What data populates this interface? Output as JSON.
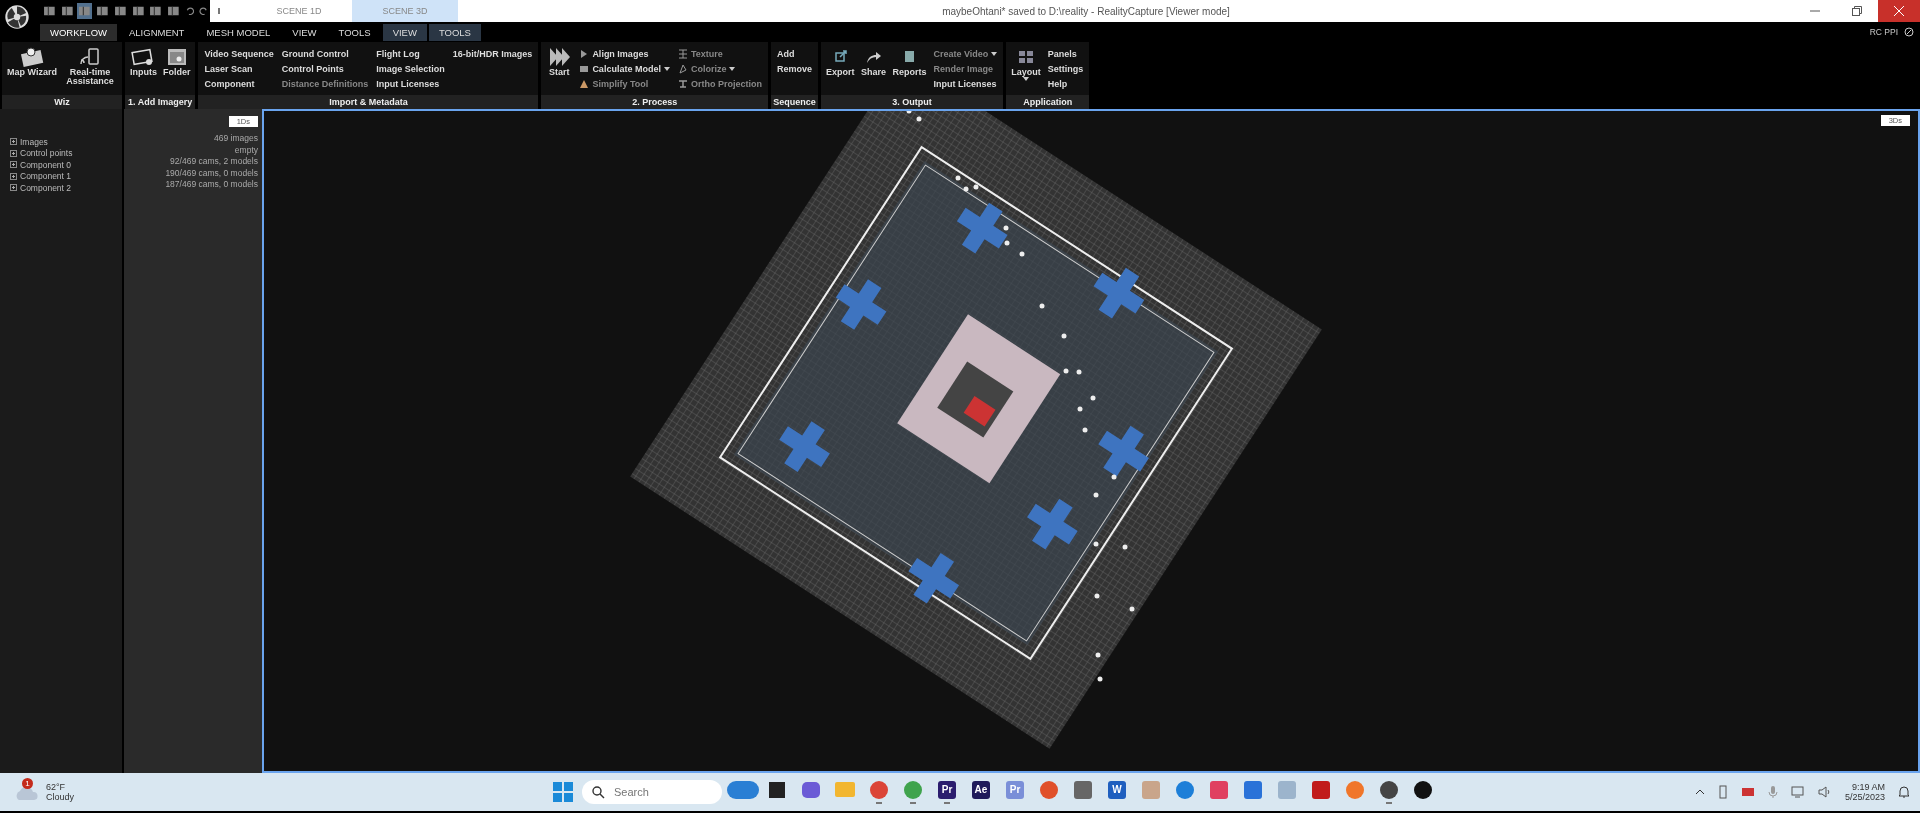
{
  "scene_tabs": [
    {
      "label": "SCENE 1D",
      "selected": false
    },
    {
      "label": "SCENE 3D",
      "selected": true
    }
  ],
  "window": {
    "title": "maybeOhtani* saved to D:\\reality - RealityCapture [Viewer mode]"
  },
  "status": "RC PPI",
  "menu_tabs": [
    {
      "label": "WORKFLOW",
      "selected": true,
      "kind": "main"
    },
    {
      "label": "ALIGNMENT",
      "selected": false,
      "kind": "main"
    },
    {
      "label": "MESH MODEL",
      "selected": false,
      "kind": "main"
    },
    {
      "label": "VIEW",
      "selected": false,
      "kind": "main"
    },
    {
      "label": "TOOLS",
      "selected": false,
      "kind": "main"
    },
    {
      "label": "VIEW",
      "selected": false,
      "kind": "context"
    },
    {
      "label": "TOOLS",
      "selected": false,
      "kind": "context"
    }
  ],
  "ribbon": [
    {
      "label": "Wiz",
      "large": [
        {
          "label": "Map Wizard",
          "kind": "map"
        },
        {
          "label": "Real-time Assistance",
          "kind": "device"
        }
      ]
    },
    {
      "label": "1. Add Imagery",
      "large": [
        {
          "label": "Inputs",
          "kind": "inputs"
        },
        {
          "label": "Folder",
          "kind": "folder"
        }
      ]
    },
    {
      "label": "Import & Metadata",
      "columns": [
        [
          {
            "label": "Video Sequence",
            "disabled": false
          },
          {
            "label": "Laser Scan",
            "disabled": false
          },
          {
            "label": "Component",
            "disabled": false
          }
        ],
        [
          {
            "label": "Ground Control",
            "disabled": false
          },
          {
            "label": "Control Points",
            "disabled": false
          },
          {
            "label": "Distance Definitions",
            "disabled": true
          }
        ],
        [
          {
            "label": "Flight Log",
            "disabled": false
          },
          {
            "label": "Image Selection",
            "disabled": false
          },
          {
            "label": "Input Licenses",
            "disabled": false
          }
        ],
        [
          {
            "label": "16-bit/HDR Images",
            "disabled": false
          }
        ]
      ]
    },
    {
      "label": "2. Process",
      "large": [
        {
          "label": "Start",
          "kind": "start"
        }
      ],
      "columns": [
        [
          {
            "label": "Align Images",
            "disabled": false
          },
          {
            "label": "Calculate Model",
            "disabled": false,
            "dropdown": true
          },
          {
            "label": "Simplify Tool",
            "disabled": true
          }
        ],
        [
          {
            "label": "Texture",
            "disabled": true
          },
          {
            "label": "Colorize",
            "disabled": true,
            "dropdown": true
          },
          {
            "label": "Ortho Projection",
            "disabled": true
          }
        ]
      ]
    },
    {
      "label": "Sequence",
      "columns": [
        [
          {
            "label": "Add",
            "disabled": false
          },
          {
            "label": "Remove",
            "disabled": false
          }
        ]
      ]
    },
    {
      "label": "3. Output",
      "large": [
        {
          "label": "Export",
          "kind": "export"
        },
        {
          "label": "Share",
          "kind": "share"
        },
        {
          "label": "Reports",
          "kind": "reports"
        }
      ],
      "columns": [
        [
          {
            "label": "Create Video",
            "disabled": true,
            "dropdown": true
          },
          {
            "label": "Render Image",
            "disabled": true
          },
          {
            "label": "Input Licenses",
            "disabled": false
          }
        ]
      ]
    },
    {
      "label": "Application",
      "large": [
        {
          "label": "Layout",
          "kind": "layout",
          "dropdown": true
        }
      ],
      "columns": [
        [
          {
            "label": "Panels",
            "disabled": false
          },
          {
            "label": "Settings",
            "disabled": false
          },
          {
            "label": "Help",
            "disabled": false
          }
        ]
      ]
    }
  ],
  "panel_1d": {
    "badge": "1Ds",
    "items": [
      {
        "label": "Images",
        "value": "469 images"
      },
      {
        "label": "Control points",
        "value": "empty"
      },
      {
        "label": "Component 0",
        "value": "92/469 cams, 2 models"
      },
      {
        "label": "Component 1",
        "value": "190/469 cams, 0 models"
      },
      {
        "label": "Component 2",
        "value": "187/469 cams, 0 models"
      }
    ]
  },
  "view_3d": {
    "badge": "3Ds"
  },
  "taskbar": {
    "weather": {
      "temp": "62°F",
      "condition": "Cloudy",
      "badge": "1"
    },
    "search": {
      "placeholder": "Search"
    },
    "apps": [
      {
        "kind": "bing",
        "color": "#2a7fd4",
        "active": false
      },
      {
        "kind": "taskview",
        "color": "#222222",
        "active": false
      },
      {
        "kind": "chat",
        "color": "#6b5bd6",
        "active": false
      },
      {
        "kind": "folder",
        "color": "#f2b630",
        "active": false
      },
      {
        "kind": "circle",
        "color": "#db4437",
        "active": true
      },
      {
        "kind": "circle",
        "color": "#3fa34d",
        "active": true
      },
      {
        "kind": "tile",
        "color": "#2b1d6e",
        "label": "Pr",
        "active": true
      },
      {
        "kind": "tile",
        "color": "#1f1a5a",
        "label": "Ae",
        "active": false
      },
      {
        "kind": "tile",
        "color": "#7a8fd8",
        "label": "Pr",
        "active": false
      },
      {
        "kind": "circle",
        "color": "#e0502a",
        "active": false
      },
      {
        "kind": "tile",
        "color": "#666666",
        "active": false
      },
      {
        "kind": "tile",
        "color": "#1f5fbf",
        "label": "W",
        "active": false
      },
      {
        "kind": "tile",
        "color": "#c9a58a",
        "active": false
      },
      {
        "kind": "circle",
        "color": "#1d7fd8",
        "active": false
      },
      {
        "kind": "tile",
        "color": "#e04060",
        "active": false
      },
      {
        "kind": "tile",
        "color": "#2a72d8",
        "active": false
      },
      {
        "kind": "tile",
        "color": "#9cb4cc",
        "active": false
      },
      {
        "kind": "tile",
        "color": "#c11b1b",
        "active": false
      },
      {
        "kind": "circle",
        "color": "#f0762a",
        "active": false
      },
      {
        "kind": "circle",
        "color": "#444444",
        "active": true
      },
      {
        "kind": "circle",
        "color": "#111111",
        "active": false
      }
    ],
    "time": "9:19 AM",
    "date": "5/25/2023"
  }
}
